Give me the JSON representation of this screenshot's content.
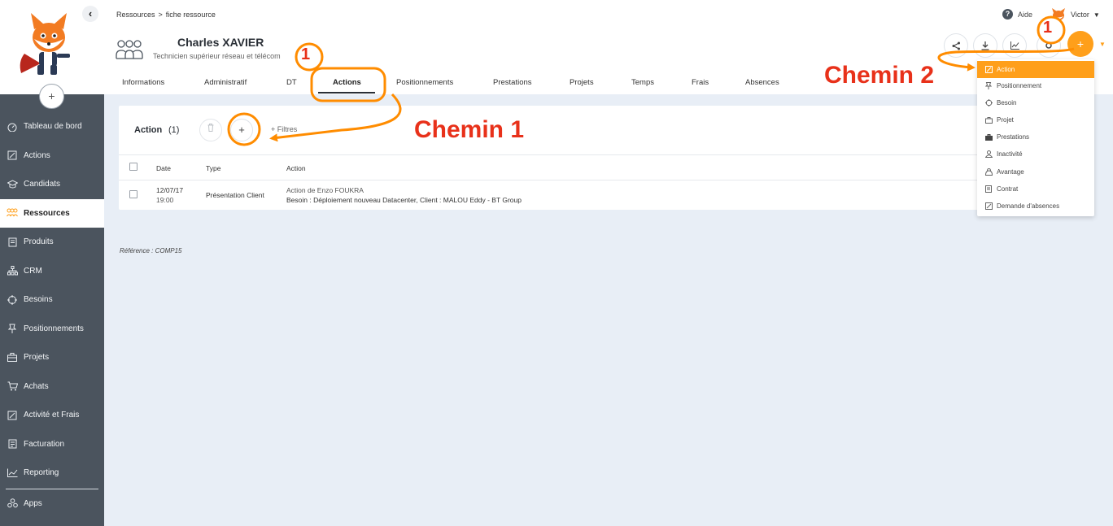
{
  "sidebar": {
    "collapse_icon": "chevron-left-icon",
    "add_icon": "+",
    "items": [
      {
        "label": "Tableau de bord",
        "icon": "dashboard-icon"
      },
      {
        "label": "Actions",
        "icon": "actions-icon"
      },
      {
        "label": "Candidats",
        "icon": "graduation-cap-icon"
      },
      {
        "label": "Ressources",
        "icon": "people-icon",
        "active": true
      },
      {
        "label": "Produits",
        "icon": "document-icon"
      },
      {
        "label": "CRM",
        "icon": "org-chart-icon"
      },
      {
        "label": "Besoins",
        "icon": "target-icon"
      },
      {
        "label": "Positionnements",
        "icon": "pin-icon"
      },
      {
        "label": "Projets",
        "icon": "briefcase-icon"
      },
      {
        "label": "Achats",
        "icon": "cart-icon"
      },
      {
        "label": "Activité et Frais",
        "icon": "edit-icon"
      },
      {
        "label": "Facturation",
        "icon": "invoice-icon"
      },
      {
        "label": "Reporting",
        "icon": "chart-icon"
      },
      {
        "label": "Apps",
        "icon": "apps-icon"
      }
    ]
  },
  "header": {
    "breadcrumb": [
      "Ressources",
      ">",
      "fiche ressource"
    ],
    "name": "Charles XAVIER",
    "role": "Technicien supérieur réseau et télécom",
    "help_label": "Aide",
    "user_name": "Victor",
    "add_label": "+",
    "tabs": [
      "Informations",
      "Administratif",
      "DT",
      "Actions",
      "Positionnements",
      "Prestations",
      "Projets",
      "Temps",
      "Frais",
      "Absences"
    ],
    "active_tab": "Actions"
  },
  "card": {
    "title": "Action",
    "count": "(1)",
    "plus_label": "+",
    "filters_label": "+ Filtres",
    "columns": [
      "Date",
      "Type",
      "Action"
    ],
    "rows": [
      {
        "date": "12/07/17",
        "time": "19:00",
        "type": "Présentation Client",
        "action_line1": "Action de Enzo FOUKRA",
        "action_line2": "Besoin : Déploiement nouveau Datacenter, Client : MALOU Eddy - BT Group"
      }
    ]
  },
  "reference": "Référence : COMP15",
  "dropdown": {
    "items": [
      {
        "label": "Action",
        "icon": "edit-icon",
        "active": true
      },
      {
        "label": "Positionnement",
        "icon": "pin-icon"
      },
      {
        "label": "Besoin",
        "icon": "target-icon"
      },
      {
        "label": "Projet",
        "icon": "briefcase-icon"
      },
      {
        "label": "Prestations",
        "icon": "case-icon"
      },
      {
        "label": "Inactivité",
        "icon": "person-warning-icon"
      },
      {
        "label": "Avantage",
        "icon": "gift-icon"
      },
      {
        "label": "Contrat",
        "icon": "contract-icon"
      },
      {
        "label": "Demande d'absences",
        "icon": "edit-icon"
      }
    ]
  },
  "annotations": {
    "step_1": "1",
    "chemin_1": "Chemin 1",
    "chemin_2": "Chemin 2",
    "accent_color": "#ff9f1a",
    "text_color": "#e8311a"
  }
}
